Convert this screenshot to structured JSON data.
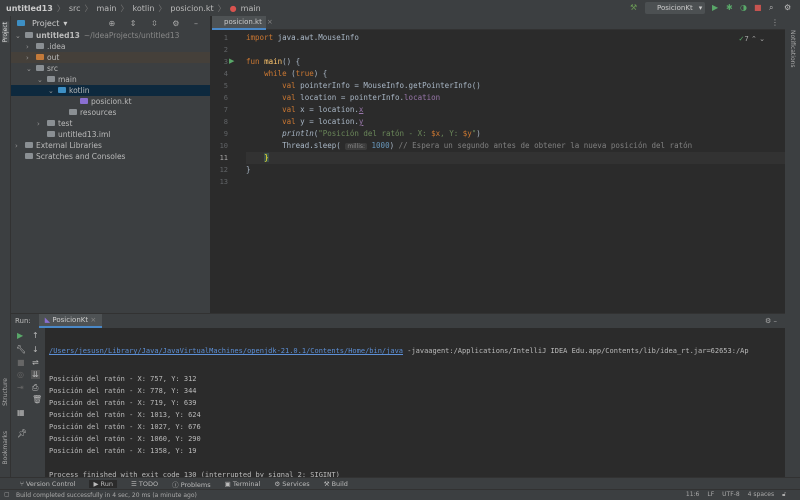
{
  "breadcrumb": [
    "untitled13",
    "src",
    "main",
    "kotlin",
    "posicion.kt",
    "main"
  ],
  "toolbar": {
    "run_config": "PosicionKt"
  },
  "left_stripe": {
    "project": "Project",
    "structure": "Structure",
    "bookmarks": "Bookmarks"
  },
  "right_stripe": {
    "notifications": "Notifications"
  },
  "project_panel": {
    "title": "Project",
    "tree": [
      {
        "label": "untitled13",
        "hint": "~/IdeaProjects/untitled13",
        "depth": 0,
        "chev": "v"
      },
      {
        "label": ".idea",
        "depth": 1,
        "chev": ">"
      },
      {
        "label": "out",
        "depth": 1,
        "chev": ">"
      },
      {
        "label": "src",
        "depth": 1,
        "chev": "v"
      },
      {
        "label": "main",
        "depth": 2,
        "chev": "v"
      },
      {
        "label": "kotlin",
        "depth": 3,
        "chev": "v"
      },
      {
        "label": "posicion.kt",
        "depth": 5,
        "chev": ""
      },
      {
        "label": "resources",
        "depth": 4,
        "chev": ""
      },
      {
        "label": "test",
        "depth": 2,
        "chev": ">"
      },
      {
        "label": "untitled13.iml",
        "depth": 2,
        "chev": ""
      },
      {
        "label": "External Libraries",
        "depth": 0,
        "chev": ">"
      },
      {
        "label": "Scratches and Consoles",
        "depth": 0,
        "chev": ""
      }
    ]
  },
  "editor": {
    "tab": "posicion.kt",
    "inspections": "7",
    "current_line": 11,
    "lines": [
      "1",
      "2",
      "3",
      "4",
      "5",
      "6",
      "7",
      "8",
      "9",
      "10",
      "11",
      "12",
      "13"
    ],
    "param_hint": "millis:"
  },
  "run": {
    "label": "Run:",
    "tab": "PosicionKt",
    "command_path": "/Users/jesusn/Library/Java/JavaVirtualMachines/openjdk-21.0.1/Contents/Home/bin/java",
    "command_args": " -javaagent:/Applications/IntelliJ IDEA Edu.app/Contents/lib/idea_rt.jar=62653:/Ap",
    "output": [
      "Posición del ratón - X: 757, Y: 312",
      "Posición del ratón - X: 778, Y: 344",
      "Posición del ratón - X: 719, Y: 639",
      "Posición del ratón - X: 1013, Y: 624",
      "Posición del ratón - X: 1027, Y: 676",
      "Posición del ratón - X: 1060, Y: 290",
      "Posición del ratón - X: 1358, Y: 19",
      "",
      "Process finished with exit code 130 (interrupted by signal 2: SIGINT)"
    ]
  },
  "tool_tabs": [
    "Version Control",
    "Run",
    "TODO",
    "Problems",
    "Terminal",
    "Services",
    "Build"
  ],
  "status": {
    "message": "Build completed successfully in 4 sec, 20 ms (a minute ago)",
    "position": "11:6",
    "line_sep": "LF",
    "encoding": "UTF-8",
    "indent": "4 spaces"
  }
}
